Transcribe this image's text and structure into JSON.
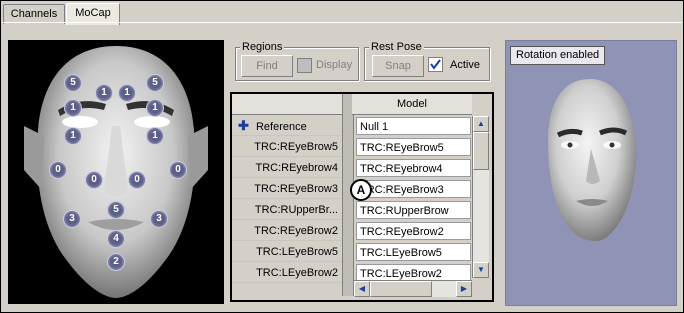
{
  "tabs": [
    {
      "label": "Channels"
    },
    {
      "label": "MoCap"
    }
  ],
  "markers": [
    "5",
    "1",
    "1",
    "5",
    "1",
    "1",
    "1",
    "1",
    "0",
    "0",
    "0",
    "0",
    "5",
    "3",
    "3",
    "4",
    "2"
  ],
  "regions": {
    "label": "Regions",
    "find": "Find",
    "display": "Display"
  },
  "rest_pose": {
    "label": "Rest Pose",
    "snap": "Snap",
    "active": "Active"
  },
  "grid": {
    "column_header": "Model",
    "rows": [
      {
        "label": "Reference",
        "model": "Null 1"
      },
      {
        "label": "TRC:REyeBrow5",
        "model": "TRC:REyeBrow5"
      },
      {
        "label": "TRC:REyebrow4",
        "model": "TRC:REyebrow4"
      },
      {
        "label": "TRC:REyeBrow3",
        "model": "TRC:REyeBrow3"
      },
      {
        "label": "TRC:RUpperBr...",
        "model": "TRC:RUpperBrow"
      },
      {
        "label": "TRC:REyeBrow2",
        "model": "TRC:REyeBrow2"
      },
      {
        "label": "TRC:LEyeBrow5",
        "model": "TRC:LEyeBrow5"
      },
      {
        "label": "TRC:LEyeBrow2",
        "model": "TRC:LEyeBrow2"
      }
    ]
  },
  "callout": "A",
  "viewer": {
    "badge": "Rotation enabled"
  },
  "colors": {
    "marker": "#5b5f88",
    "viewer_bg": "#8f94b7",
    "face_bg": "#000000"
  }
}
